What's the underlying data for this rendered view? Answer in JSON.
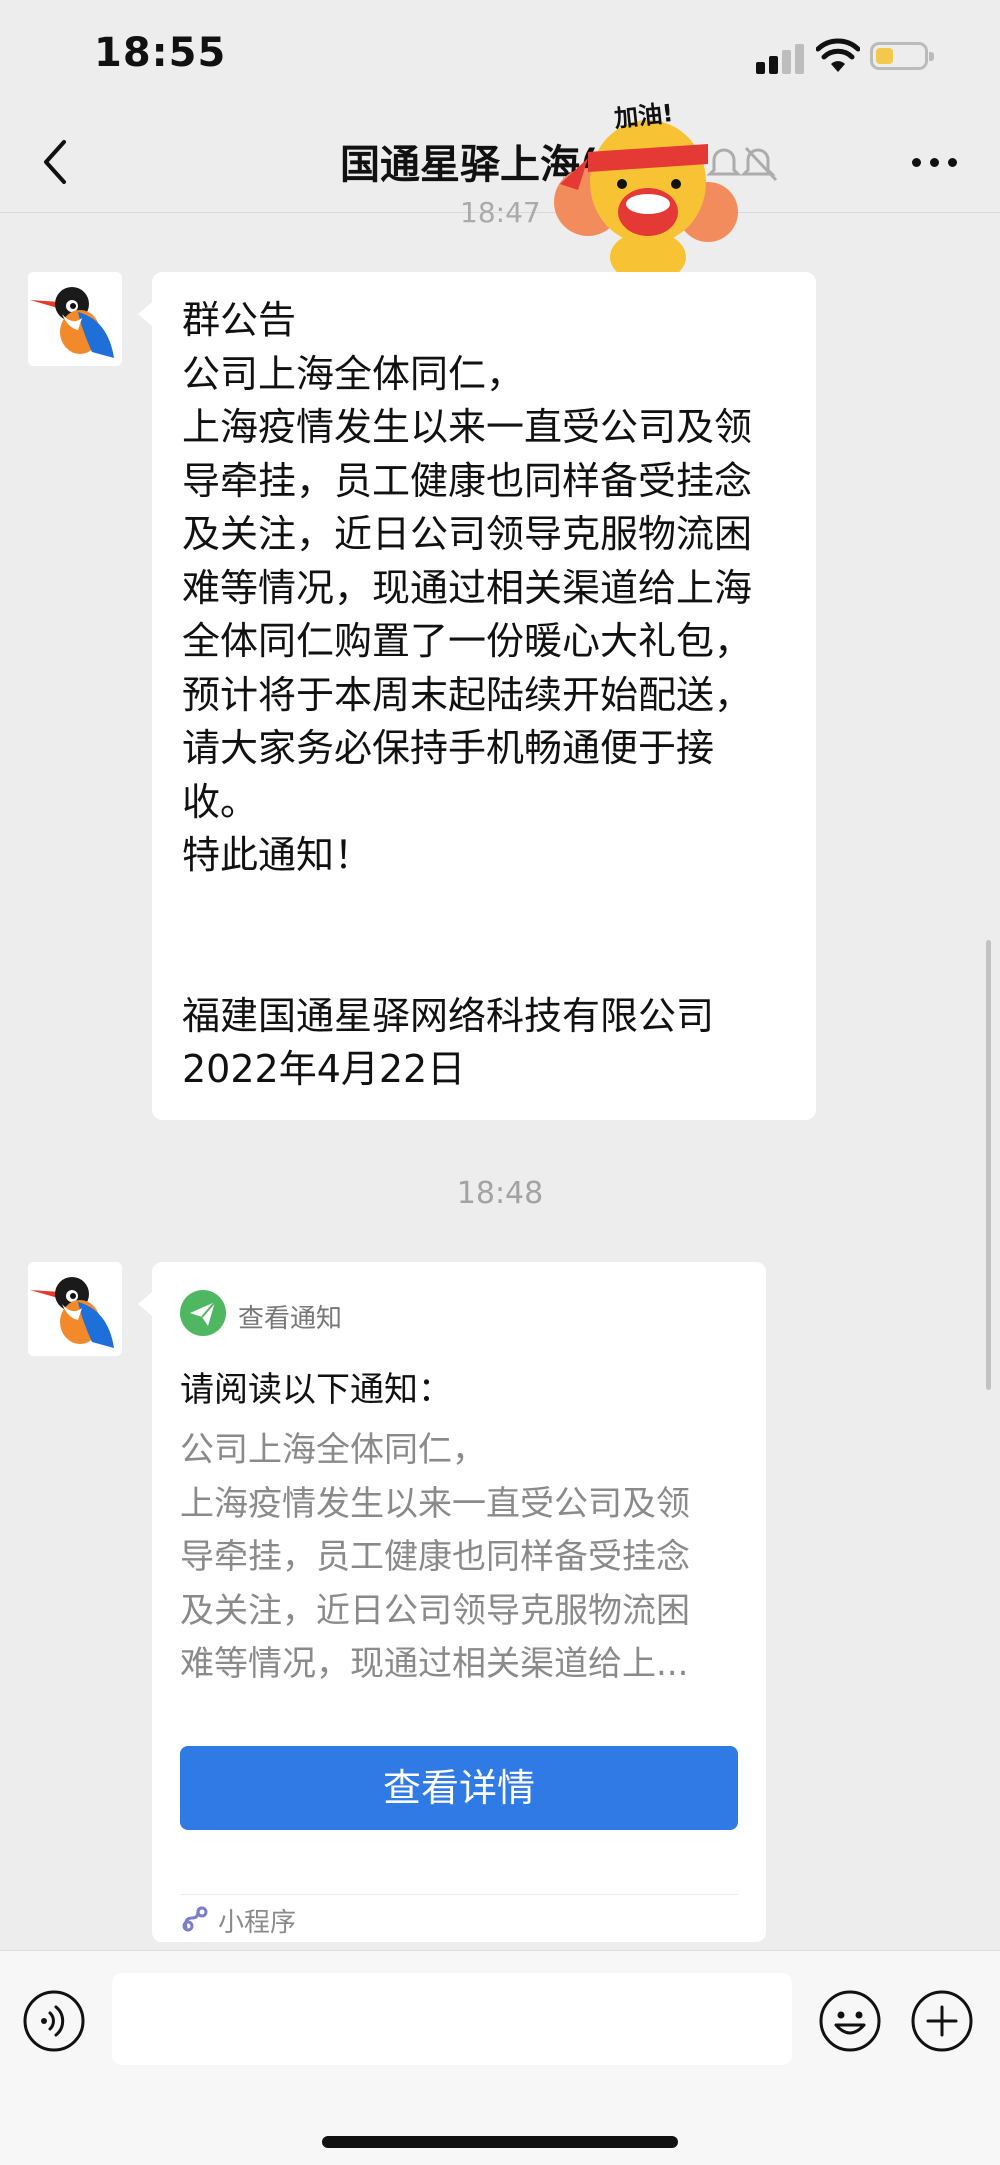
{
  "status_bar": {
    "time": "18:55",
    "battery_level": 0.3
  },
  "header": {
    "title": "国通星驿上海(",
    "sticker_text": "加油!",
    "hidden_time": "18:47"
  },
  "messages": [
    {
      "type": "text",
      "lines": [
        "群公告",
        "公司上海全体同仁，",
        "上海疫情发生以来一直受公司及领",
        "导牵挂，员工健康也同样备受挂念",
        "及关注，近日公司领导克服物流困",
        "难等情况，现通过相关渠道给上海",
        "全体同仁购置了一份暖心大礼包，",
        "预计将于本周末起陆续开始配送，",
        "请大家务必保持手机畅通便于接",
        "收。",
        "特此通知！",
        "",
        "",
        "福建国通星驿网络科技有限公司",
        "2022年4月22日"
      ]
    },
    {
      "type": "mini_program_card",
      "time_divider": "18:48",
      "app_name": "查看通知",
      "title": "请阅读以下通知：",
      "body_lines": [
        "公司上海全体同仁，",
        "上海疫情发生以来一直受公司及领",
        "导牵挂，员工健康也同样备受挂念",
        "及关注，近日公司领导克服物流困",
        "难等情况，现通过相关渠道给上..."
      ],
      "button_label": "查看详情",
      "footer_label": "小程序"
    }
  ],
  "input_bar": {
    "value": "",
    "placeholder": ""
  },
  "colors": {
    "background": "#ededed",
    "button": "#2f7ae5",
    "app_icon": "#4fb662"
  },
  "icons": [
    "back-icon",
    "more-icon",
    "voice-icon",
    "emoji-icon",
    "plus-icon",
    "send-icon",
    "mini-program-icon"
  ]
}
